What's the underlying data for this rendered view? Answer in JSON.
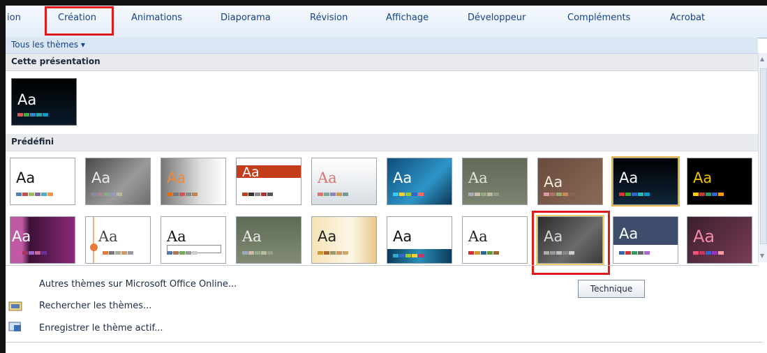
{
  "ribbon": {
    "tabs": [
      "ion",
      "Création",
      "Animations",
      "Diaporama",
      "Révision",
      "Affichage",
      "Développeur",
      "Compléments",
      "Acrobat"
    ],
    "active_tab": "Création"
  },
  "gallery": {
    "all_themes": "Tous les thèmes ▾",
    "section_current": "Cette présentation",
    "section_builtin": "Prédéfini",
    "thumb_label": "Aa",
    "tooltip": "Technique"
  },
  "menu": {
    "more_online": "Autres thèmes sur Microsoft Office Online...",
    "browse": "Rechercher les thèmes...",
    "save": "Enregistrer le thème actif..."
  },
  "colors": {
    "highlight_red": "#e01b1b",
    "tab_text": "#15428b"
  }
}
